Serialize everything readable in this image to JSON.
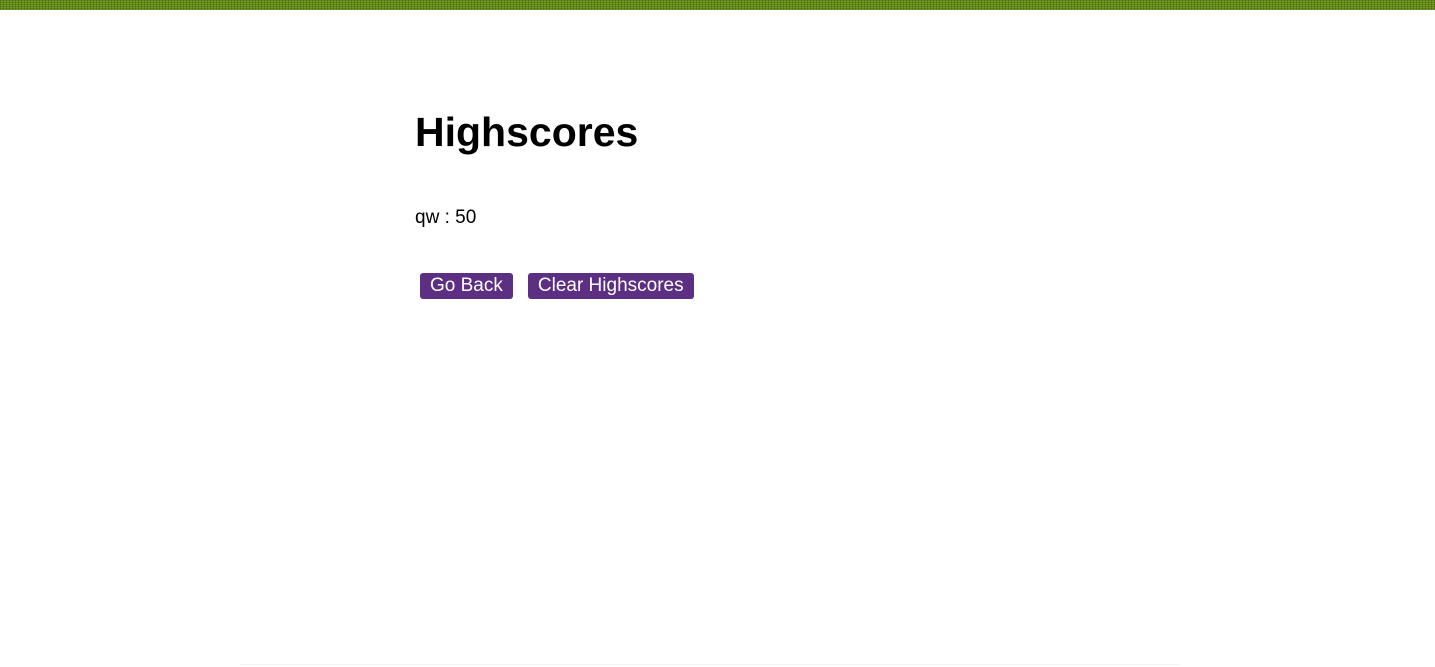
{
  "page": {
    "title": "Highscores"
  },
  "scores": [
    {
      "entry": "qw : 50"
    }
  ],
  "actions": {
    "go_back_label": "Go Back",
    "clear_label": "Clear Highscores"
  },
  "colors": {
    "accent_button": "#5c2f82",
    "top_strip": "#5f8a0f",
    "background": "#ffffff"
  }
}
